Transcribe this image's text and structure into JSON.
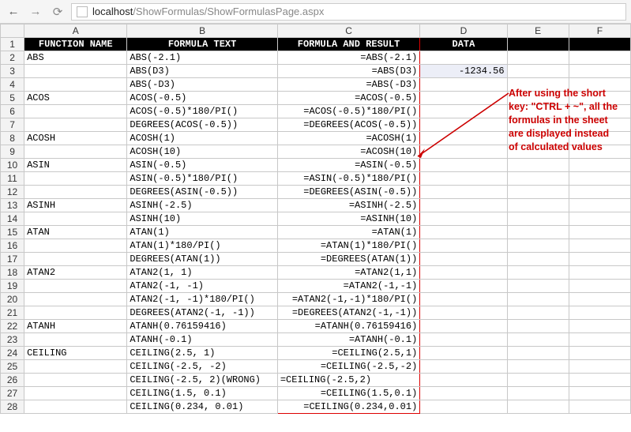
{
  "url": {
    "host": "localhost",
    "path": "/ShowFormulas/ShowFormulasPage.aspx"
  },
  "columns": [
    "A",
    "B",
    "C",
    "D",
    "E",
    "F"
  ],
  "header": {
    "A": "FUNCTION NAME",
    "B": "FORMULA TEXT",
    "C": "FORMULA AND RESULT",
    "D": "DATA"
  },
  "annotation": "After using the short key: \"CTRL + ~\", all the formulas in the sheet are displayed instead of calculated values",
  "rows": [
    {
      "n": 2,
      "A": "ABS",
      "B": "ABS(-2.1)",
      "C": "=ABS(-2.1)"
    },
    {
      "n": 3,
      "A": "",
      "B": "ABS(D3)",
      "C": "=ABS(D3)",
      "D": "-1234.56",
      "Dsel": true
    },
    {
      "n": 4,
      "A": "",
      "B": "ABS(-D3)",
      "C": "=ABS(-D3)"
    },
    {
      "n": 5,
      "A": "ACOS",
      "B": "ACOS(-0.5)",
      "C": "=ACOS(-0.5)"
    },
    {
      "n": 6,
      "A": "",
      "B": "ACOS(-0.5)*180/PI()",
      "C": "=ACOS(-0.5)*180/PI()"
    },
    {
      "n": 7,
      "A": "",
      "B": "DEGREES(ACOS(-0.5))",
      "C": "=DEGREES(ACOS(-0.5))"
    },
    {
      "n": 8,
      "A": "ACOSH",
      "B": "ACOSH(1)",
      "C": "=ACOSH(1)"
    },
    {
      "n": 9,
      "A": "",
      "B": "ACOSH(10)",
      "C": "=ACOSH(10)"
    },
    {
      "n": 10,
      "A": "ASIN",
      "B": "ASIN(-0.5)",
      "C": "=ASIN(-0.5)"
    },
    {
      "n": 11,
      "A": "",
      "B": "ASIN(-0.5)*180/PI()",
      "C": "=ASIN(-0.5)*180/PI()"
    },
    {
      "n": 12,
      "A": "",
      "B": "DEGREES(ASIN(-0.5))",
      "C": "=DEGREES(ASIN(-0.5))"
    },
    {
      "n": 13,
      "A": "ASINH",
      "B": "ASINH(-2.5)",
      "C": "=ASINH(-2.5)"
    },
    {
      "n": 14,
      "A": "",
      "B": "ASINH(10)",
      "C": "=ASINH(10)"
    },
    {
      "n": 15,
      "A": "ATAN",
      "B": "ATAN(1)",
      "C": "=ATAN(1)"
    },
    {
      "n": 16,
      "A": "",
      "B": "ATAN(1)*180/PI()",
      "C": "=ATAN(1)*180/PI()"
    },
    {
      "n": 17,
      "A": "",
      "B": "DEGREES(ATAN(1))",
      "C": "=DEGREES(ATAN(1))"
    },
    {
      "n": 18,
      "A": "ATAN2",
      "B": "ATAN2(1, 1)",
      "C": "=ATAN2(1,1)"
    },
    {
      "n": 19,
      "A": "",
      "B": "ATAN2(-1, -1)",
      "C": "=ATAN2(-1,-1)"
    },
    {
      "n": 20,
      "A": "",
      "B": "ATAN2(-1, -1)*180/PI()",
      "C": "=ATAN2(-1,-1)*180/PI()"
    },
    {
      "n": 21,
      "A": "",
      "B": "DEGREES(ATAN2(-1, -1))",
      "C": "=DEGREES(ATAN2(-1,-1))"
    },
    {
      "n": 22,
      "A": "ATANH",
      "B": "ATANH(0.76159416)",
      "C": "=ATANH(0.76159416)"
    },
    {
      "n": 23,
      "A": "",
      "B": "ATANH(-0.1)",
      "C": "=ATANH(-0.1)"
    },
    {
      "n": 24,
      "A": "CEILING",
      "B": "CEILING(2.5, 1)",
      "C": "=CEILING(2.5,1)"
    },
    {
      "n": 25,
      "A": "",
      "B": "CEILING(-2.5, -2)",
      "C": "=CEILING(-2.5,-2)"
    },
    {
      "n": 26,
      "A": "",
      "B": "CEILING(-2.5, 2)(WRONG)",
      "C": "=CEILING(-2.5,2)",
      "Cleft": true
    },
    {
      "n": 27,
      "A": "",
      "B": "CEILING(1.5, 0.1)",
      "C": "=CEILING(1.5,0.1)"
    },
    {
      "n": 28,
      "A": "",
      "B": "CEILING(0.234, 0.01)",
      "C": "=CEILING(0.234,0.01)"
    }
  ]
}
